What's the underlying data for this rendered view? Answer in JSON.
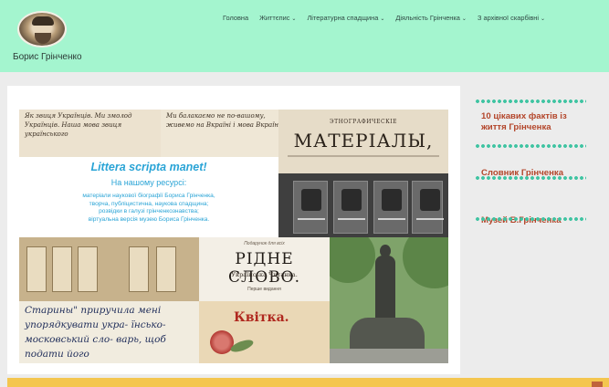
{
  "header": {
    "site_title": "Борис Грінченко",
    "nav": [
      {
        "label": "Головна",
        "has_dropdown": false
      },
      {
        "label": "Життєпис",
        "has_dropdown": true
      },
      {
        "label": "Літературна спадщина",
        "has_dropdown": true
      },
      {
        "label": "Діяльність Грінченка",
        "has_dropdown": true
      },
      {
        "label": "З архівної скарбівні",
        "has_dropdown": true
      }
    ],
    "caret_glyph": "⌄"
  },
  "collage": {
    "handwriting_1": "Як звиця Українців. Ми змолод Українців. Наша мова звиця українського",
    "handwriting_2": "Ми балакаємо не по-вашому, живемо на Вкраїні і мова Вкраїнська",
    "etno_small": "ЭТНОГРАФИЧЕСКІЕ",
    "etno_big": "МАТЕРІАЛЫ,",
    "banner_title": "Littera scripta manet!",
    "banner_subtitle": "На нашому ресурсі:",
    "banner_lines": [
      "матеріали наукової біографії Бориса Грінченка,",
      "творча, публіцистична, наукова спадщина;",
      "розвідки в галузі грінченкознавства;",
      "віртуальна версія музею Бориса Грінченка."
    ],
    "ridne_top": "Подарунок для всіх",
    "ridne_title": "РІДНЕ СЛОВО.",
    "ridne_subtitle": "Українська Читанка.",
    "ridne_footer": "Перше видання",
    "handwriting_3": "Старины\" приручила мені упорядкувати укра- їнсько-московський сло- варь, щоб подати його",
    "kvitka_title": "Квітка."
  },
  "sidebar": {
    "links": [
      "10 цікавих фактів із життя Грінченка",
      "Словник Грінченка",
      "Музей Б.Грінченка"
    ]
  },
  "colors": {
    "header_bg": "#a4f5cf",
    "accent_link": "#b3452a",
    "banner_text": "#2aa4d6",
    "dots": "#3fc4a2",
    "bottom_bar": "#f4c64f"
  }
}
